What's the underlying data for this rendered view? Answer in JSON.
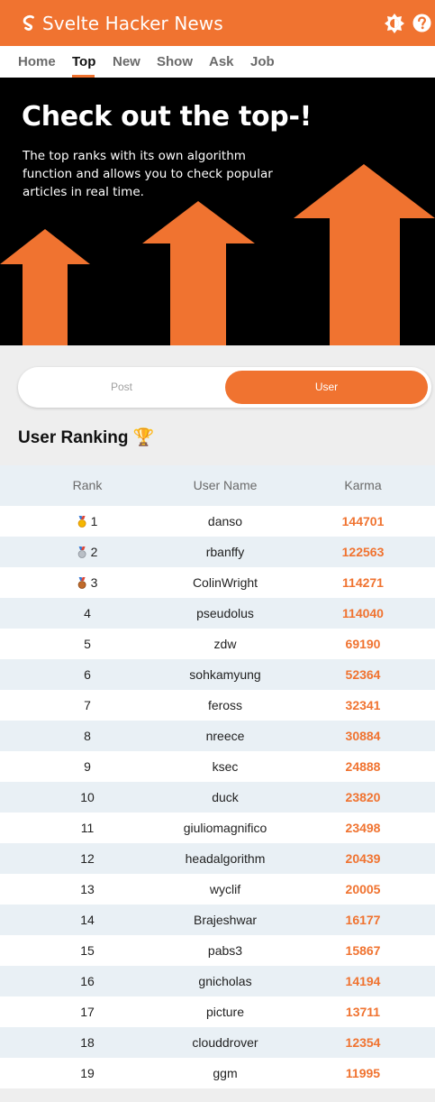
{
  "app": {
    "title": "Svelte Hacker News",
    "logo_icon": "svelte-logo-icon",
    "theme_icon": "brightness-icon",
    "help_icon": "help-icon"
  },
  "colors": {
    "accent": "#f07330",
    "stripe": "#e9f0f5",
    "background": "#eeeeee"
  },
  "tabs": [
    {
      "label": "Home",
      "active": false
    },
    {
      "label": "Top",
      "active": true
    },
    {
      "label": "New",
      "active": false
    },
    {
      "label": "Show",
      "active": false
    },
    {
      "label": "Ask",
      "active": false
    },
    {
      "label": "Job",
      "active": false
    }
  ],
  "banner": {
    "title": "Check out the top-!",
    "description": "The top ranks with its own algorithm function and allows you to check popular articles in real time."
  },
  "toggle": {
    "post_label": "Post",
    "user_label": "User",
    "selected": "User"
  },
  "ranking": {
    "title": "User Ranking 🏆",
    "headers": {
      "rank": "Rank",
      "user": "User Name",
      "karma": "Karma"
    },
    "rows": [
      {
        "rank": "1",
        "medal": "gold",
        "user": "danso",
        "karma": "144701"
      },
      {
        "rank": "2",
        "medal": "silver",
        "user": "rbanffy",
        "karma": "122563"
      },
      {
        "rank": "3",
        "medal": "bronze",
        "user": "ColinWright",
        "karma": "114271"
      },
      {
        "rank": "4",
        "user": "pseudolus",
        "karma": "114040"
      },
      {
        "rank": "5",
        "user": "zdw",
        "karma": "69190"
      },
      {
        "rank": "6",
        "user": "sohkamyung",
        "karma": "52364"
      },
      {
        "rank": "7",
        "user": "feross",
        "karma": "32341"
      },
      {
        "rank": "8",
        "user": "nreece",
        "karma": "30884"
      },
      {
        "rank": "9",
        "user": "ksec",
        "karma": "24888"
      },
      {
        "rank": "10",
        "user": "duck",
        "karma": "23820"
      },
      {
        "rank": "11",
        "user": "giuliomagnifico",
        "karma": "23498"
      },
      {
        "rank": "12",
        "user": "headalgorithm",
        "karma": "20439"
      },
      {
        "rank": "13",
        "user": "wyclif",
        "karma": "20005"
      },
      {
        "rank": "14",
        "user": "Brajeshwar",
        "karma": "16177"
      },
      {
        "rank": "15",
        "user": "pabs3",
        "karma": "15867"
      },
      {
        "rank": "16",
        "user": "gnicholas",
        "karma": "14194"
      },
      {
        "rank": "17",
        "user": "picture",
        "karma": "13711"
      },
      {
        "rank": "18",
        "user": "clouddrover",
        "karma": "12354"
      },
      {
        "rank": "19",
        "user": "ggm",
        "karma": "11995"
      }
    ]
  }
}
